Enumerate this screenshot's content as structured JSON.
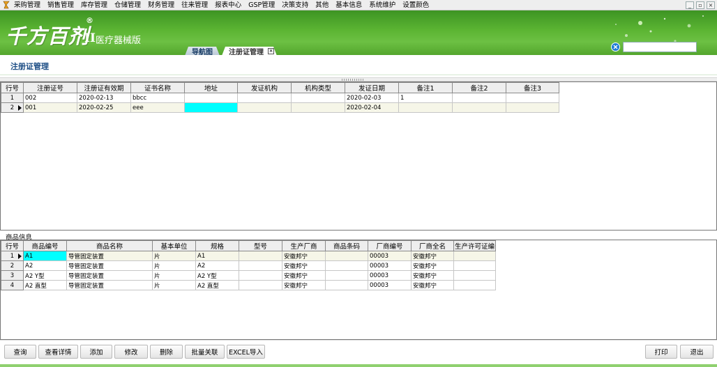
{
  "menubar": {
    "items": [
      "采购管理",
      "销售管理",
      "库存管理",
      "仓储管理",
      "财务管理",
      "往来管理",
      "报表中心",
      "GSP管理",
      "决策支持",
      "其他",
      "基本信息",
      "系统维护",
      "设置颜色"
    ]
  },
  "branding": {
    "logo_text": "千方百剂",
    "logo_suffix": "II",
    "logo_reg": "®",
    "product_line": "医疗器械版"
  },
  "tabs": [
    {
      "label": "导航图",
      "active": false
    },
    {
      "label": "注册证管理",
      "active": true
    }
  ],
  "search": {
    "value": "",
    "placeholder": ""
  },
  "page": {
    "title": "注册证管理"
  },
  "cert_grid": {
    "columns": [
      "行号",
      "注册证号",
      "注册证有效期",
      "证书名称",
      "地址",
      "发证机构",
      "机构类型",
      "发证日期",
      "备注1",
      "备注2",
      "备注3"
    ],
    "rows": [
      {
        "row": "1",
        "cells": [
          "002",
          "2020-02-13",
          "bbcc",
          "",
          "",
          "",
          "2020-02-03",
          "1",
          "",
          ""
        ]
      },
      {
        "row": "2",
        "cells": [
          "001",
          "2020-02-25",
          "eee",
          "",
          "",
          "",
          "2020-02-04",
          "",
          "",
          ""
        ]
      }
    ]
  },
  "product_section": {
    "label": "商品信息"
  },
  "product_grid": {
    "columns": [
      "行号",
      "商品编号",
      "商品名称",
      "基本单位",
      "规格",
      "型号",
      "生产厂商",
      "商品条码",
      "厂商编号",
      "厂商全名",
      "生产许可证编号"
    ],
    "rows": [
      {
        "row": "1",
        "cells": [
          "A1",
          "导管固定装置",
          "片",
          "A1",
          "",
          "安徽邦宁",
          "",
          "00003",
          "安徽邦宁",
          ""
        ]
      },
      {
        "row": "2",
        "cells": [
          "A2",
          "导管固定装置",
          "片",
          "A2",
          "",
          "安徽邦宁",
          "",
          "00003",
          "安徽邦宁",
          ""
        ]
      },
      {
        "row": "3",
        "cells": [
          "A2 Y型",
          "导管固定装置",
          "片",
          "A2 Y型",
          "",
          "安徽邦宁",
          "",
          "00003",
          "安徽邦宁",
          ""
        ]
      },
      {
        "row": "4",
        "cells": [
          "A2 直型",
          "导管固定装置",
          "片",
          "A2 直型",
          "",
          "安徽邦宁",
          "",
          "00003",
          "安徽邦宁",
          ""
        ]
      }
    ]
  },
  "buttons": {
    "query": "查询",
    "view_detail": "查看详情",
    "add": "添加",
    "edit": "修改",
    "delete": "删除",
    "batch_link": "批量关联",
    "excel_import": "EXCEL导入",
    "print": "打印",
    "exit": "退出"
  },
  "colors": {
    "banner_green": "#5cb533",
    "title_blue": "#1e4f86",
    "selected_cell": "#00ffff",
    "selected_row": "#f6f6e8"
  }
}
